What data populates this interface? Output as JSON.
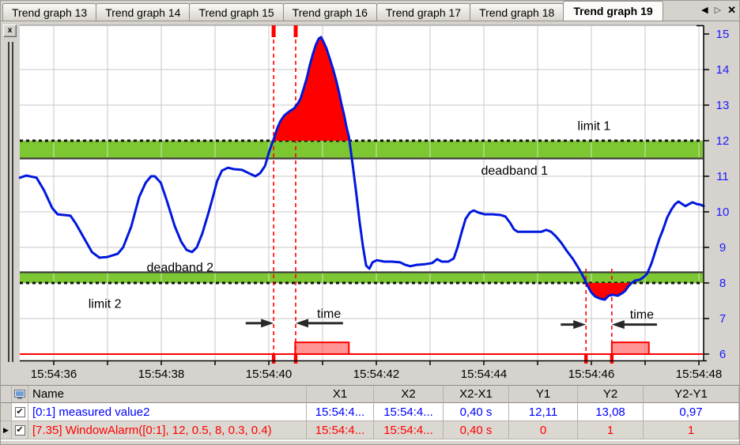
{
  "tabs": {
    "items": [
      {
        "label": "Trend graph 13"
      },
      {
        "label": "Trend graph 14"
      },
      {
        "label": "Trend graph 15"
      },
      {
        "label": "Trend graph 16"
      },
      {
        "label": "Trend graph 17"
      },
      {
        "label": "Trend graph 18"
      },
      {
        "label": "Trend graph 19"
      }
    ],
    "active_index": 6,
    "nav": {
      "prev": "◀",
      "next": "▷",
      "close": "✕"
    }
  },
  "chart_pane": {
    "close_label": "x"
  },
  "chart_data": {
    "type": "line",
    "x_axis": {
      "unit": "time",
      "tick_seconds": [
        36,
        37,
        38,
        39,
        40,
        41,
        42,
        43,
        44,
        45,
        46,
        47,
        48
      ],
      "labeled_ticks": [
        {
          "s": 36,
          "label": "15:54:36"
        },
        {
          "s": 38,
          "label": "15:54:38"
        },
        {
          "s": 40,
          "label": "15:54:40"
        },
        {
          "s": 42,
          "label": "15:54:42"
        },
        {
          "s": 44,
          "label": "15:54:44"
        },
        {
          "s": 46,
          "label": "15:54:46"
        },
        {
          "s": 48,
          "label": "15:54:48"
        }
      ],
      "range_seconds": [
        35.37,
        48.1
      ],
      "label_color": "#000000"
    },
    "y_axis": {
      "ticks": [
        6,
        7,
        8,
        9,
        10,
        11,
        12,
        13,
        14,
        15
      ],
      "range": [
        5.8,
        15.25
      ],
      "side": "right",
      "label_color": "#1a1aff"
    },
    "grid": {
      "on": true,
      "color": "#c7c7c7"
    },
    "limits": {
      "limit1": 12,
      "deadband1_range": [
        11.5,
        12
      ],
      "limit2": 8,
      "deadband2_range": [
        8,
        8.3
      ],
      "band_color": "#7dc832",
      "band_edge_color": "#3f3f3f",
      "dotted_line_color": "#111111",
      "exceed_fill_color": "#ff0000"
    },
    "series": [
      {
        "name": "[0:1] measured value2",
        "color": "#0018dd",
        "points": [
          [
            35.37,
            10.96
          ],
          [
            35.49,
            11.02
          ],
          [
            35.68,
            10.96
          ],
          [
            35.82,
            10.6
          ],
          [
            35.97,
            10.11
          ],
          [
            36.07,
            9.93
          ],
          [
            36.31,
            9.89
          ],
          [
            36.41,
            9.67
          ],
          [
            36.56,
            9.27
          ],
          [
            36.71,
            8.87
          ],
          [
            36.85,
            8.71
          ],
          [
            37.0,
            8.73
          ],
          [
            37.19,
            8.82
          ],
          [
            37.29,
            9.0
          ],
          [
            37.44,
            9.58
          ],
          [
            37.59,
            10.42
          ],
          [
            37.71,
            10.82
          ],
          [
            37.81,
            11.0
          ],
          [
            37.88,
            11.0
          ],
          [
            37.99,
            10.82
          ],
          [
            38.1,
            10.33
          ],
          [
            38.25,
            9.6
          ],
          [
            38.37,
            9.16
          ],
          [
            38.47,
            8.93
          ],
          [
            38.57,
            8.87
          ],
          [
            38.66,
            9.0
          ],
          [
            38.76,
            9.38
          ],
          [
            38.87,
            9.93
          ],
          [
            38.96,
            10.42
          ],
          [
            39.04,
            10.87
          ],
          [
            39.13,
            11.16
          ],
          [
            39.24,
            11.24
          ],
          [
            39.35,
            11.2
          ],
          [
            39.5,
            11.18
          ],
          [
            39.65,
            11.07
          ],
          [
            39.75,
            11.0
          ],
          [
            39.84,
            11.09
          ],
          [
            39.93,
            11.29
          ],
          [
            40.01,
            11.71
          ],
          [
            40.09,
            12.04
          ],
          [
            40.16,
            12.36
          ],
          [
            40.22,
            12.56
          ],
          [
            40.29,
            12.71
          ],
          [
            40.38,
            12.82
          ],
          [
            40.47,
            12.91
          ],
          [
            40.53,
            13.02
          ],
          [
            40.59,
            13.18
          ],
          [
            40.65,
            13.47
          ],
          [
            40.71,
            13.78
          ],
          [
            40.76,
            14.11
          ],
          [
            40.82,
            14.44
          ],
          [
            40.88,
            14.71
          ],
          [
            40.93,
            14.87
          ],
          [
            40.97,
            14.91
          ],
          [
            41.01,
            14.8
          ],
          [
            41.07,
            14.6
          ],
          [
            41.13,
            14.33
          ],
          [
            41.19,
            14.04
          ],
          [
            41.25,
            13.71
          ],
          [
            41.31,
            13.33
          ],
          [
            41.35,
            13.04
          ],
          [
            41.4,
            12.73
          ],
          [
            41.44,
            12.42
          ],
          [
            41.49,
            12.11
          ],
          [
            41.53,
            11.67
          ],
          [
            41.57,
            11.2
          ],
          [
            41.63,
            10.49
          ],
          [
            41.69,
            9.71
          ],
          [
            41.75,
            9.04
          ],
          [
            41.81,
            8.49
          ],
          [
            41.87,
            8.4
          ],
          [
            41.93,
            8.58
          ],
          [
            42.01,
            8.64
          ],
          [
            42.15,
            8.6
          ],
          [
            42.29,
            8.6
          ],
          [
            42.44,
            8.58
          ],
          [
            42.54,
            8.51
          ],
          [
            42.63,
            8.47
          ],
          [
            42.75,
            8.51
          ],
          [
            42.91,
            8.53
          ],
          [
            43.04,
            8.56
          ],
          [
            43.13,
            8.67
          ],
          [
            43.22,
            8.6
          ],
          [
            43.34,
            8.6
          ],
          [
            43.44,
            8.69
          ],
          [
            43.51,
            9.0
          ],
          [
            43.59,
            9.44
          ],
          [
            43.66,
            9.8
          ],
          [
            43.74,
            9.98
          ],
          [
            43.81,
            10.04
          ],
          [
            43.9,
            9.98
          ],
          [
            44.01,
            9.93
          ],
          [
            44.16,
            9.93
          ],
          [
            44.31,
            9.91
          ],
          [
            44.4,
            9.87
          ],
          [
            44.49,
            9.69
          ],
          [
            44.56,
            9.51
          ],
          [
            44.63,
            9.44
          ],
          [
            44.76,
            9.44
          ],
          [
            44.93,
            9.44
          ],
          [
            45.07,
            9.44
          ],
          [
            45.16,
            9.49
          ],
          [
            45.25,
            9.44
          ],
          [
            45.34,
            9.31
          ],
          [
            45.44,
            9.13
          ],
          [
            45.54,
            8.91
          ],
          [
            45.65,
            8.69
          ],
          [
            45.74,
            8.47
          ],
          [
            45.81,
            8.29
          ],
          [
            45.88,
            8.09
          ],
          [
            45.94,
            7.89
          ],
          [
            46.0,
            7.73
          ],
          [
            46.07,
            7.62
          ],
          [
            46.16,
            7.56
          ],
          [
            46.25,
            7.53
          ],
          [
            46.32,
            7.64
          ],
          [
            46.4,
            7.67
          ],
          [
            46.49,
            7.64
          ],
          [
            46.57,
            7.71
          ],
          [
            46.63,
            7.78
          ],
          [
            46.69,
            7.91
          ],
          [
            46.75,
            8.0
          ],
          [
            46.82,
            8.07
          ],
          [
            46.9,
            8.09
          ],
          [
            46.97,
            8.16
          ],
          [
            47.04,
            8.27
          ],
          [
            47.12,
            8.56
          ],
          [
            47.19,
            8.89
          ],
          [
            47.26,
            9.22
          ],
          [
            47.34,
            9.53
          ],
          [
            47.41,
            9.84
          ],
          [
            47.49,
            10.07
          ],
          [
            47.56,
            10.22
          ],
          [
            47.62,
            10.29
          ],
          [
            47.69,
            10.22
          ],
          [
            47.75,
            10.16
          ],
          [
            47.82,
            10.22
          ],
          [
            47.88,
            10.27
          ],
          [
            47.96,
            10.22
          ],
          [
            48.03,
            10.2
          ],
          [
            48.09,
            10.16
          ]
        ]
      },
      {
        "name": "[7.35] WindowAlarm([0:1], 12, 0.5, 8, 0.3, 0.4)",
        "type": "digital",
        "color": "#ff0000",
        "fill": "rgba(255,60,60,0.55)",
        "low_value": 6.0,
        "high_value": 6.33,
        "pulses_s": [
          [
            40.49,
            41.49
          ],
          [
            46.38,
            47.07
          ]
        ]
      }
    ],
    "cursors": [
      {
        "t": 40.09,
        "full_height": true
      },
      {
        "t": 40.5,
        "full_height": true
      },
      {
        "t": 45.9,
        "full_height": false
      },
      {
        "t": 46.38,
        "full_height": false
      }
    ],
    "cursor_color": "#ff0000",
    "time_arrows": [
      {
        "v": 6.87,
        "left_from_s": 39.57,
        "between_s": [
          40.09,
          40.5
        ],
        "right_to_s": 41.38
      },
      {
        "v": 6.83,
        "left_from_s": 45.43,
        "between_s": [
          45.9,
          46.38
        ],
        "right_to_s": 47.22
      }
    ],
    "annotations": [
      {
        "text": "limit 1",
        "t": 46.05,
        "v": 12.3
      },
      {
        "text": "deadband 1",
        "t": 44.57,
        "v": 11.04
      },
      {
        "text": "deadband 2",
        "t": 38.35,
        "v": 8.32
      },
      {
        "text": "limit 2",
        "t": 36.95,
        "v": 7.3
      },
      {
        "text": "time",
        "t": 41.12,
        "v": 7.02
      },
      {
        "text": "time",
        "t": 46.94,
        "v": 7.0
      }
    ]
  },
  "table": {
    "columns": [
      "Name",
      "X1",
      "X2",
      "X2-X1",
      "Y1",
      "Y2",
      "Y2-Y1"
    ],
    "check_glyph": "✔",
    "selected_marker": "▶",
    "rows": [
      {
        "visible": true,
        "selected": false,
        "color": "#0000ff",
        "name": "[0:1] measured value2",
        "x1": "15:54:4...",
        "x2": "15:54:4...",
        "dx": "0,40 s",
        "y1": "12,11",
        "y2": "13,08",
        "dy": "0,97"
      },
      {
        "visible": true,
        "selected": true,
        "color": "#ff0000",
        "name": "[7.35] WindowAlarm([0:1], 12, 0.5, 8, 0.3, 0.4)",
        "x1": "15:54:4...",
        "x2": "15:54:4...",
        "dx": "0,40 s",
        "y1": "0",
        "y2": "1",
        "dy": "1"
      }
    ]
  }
}
